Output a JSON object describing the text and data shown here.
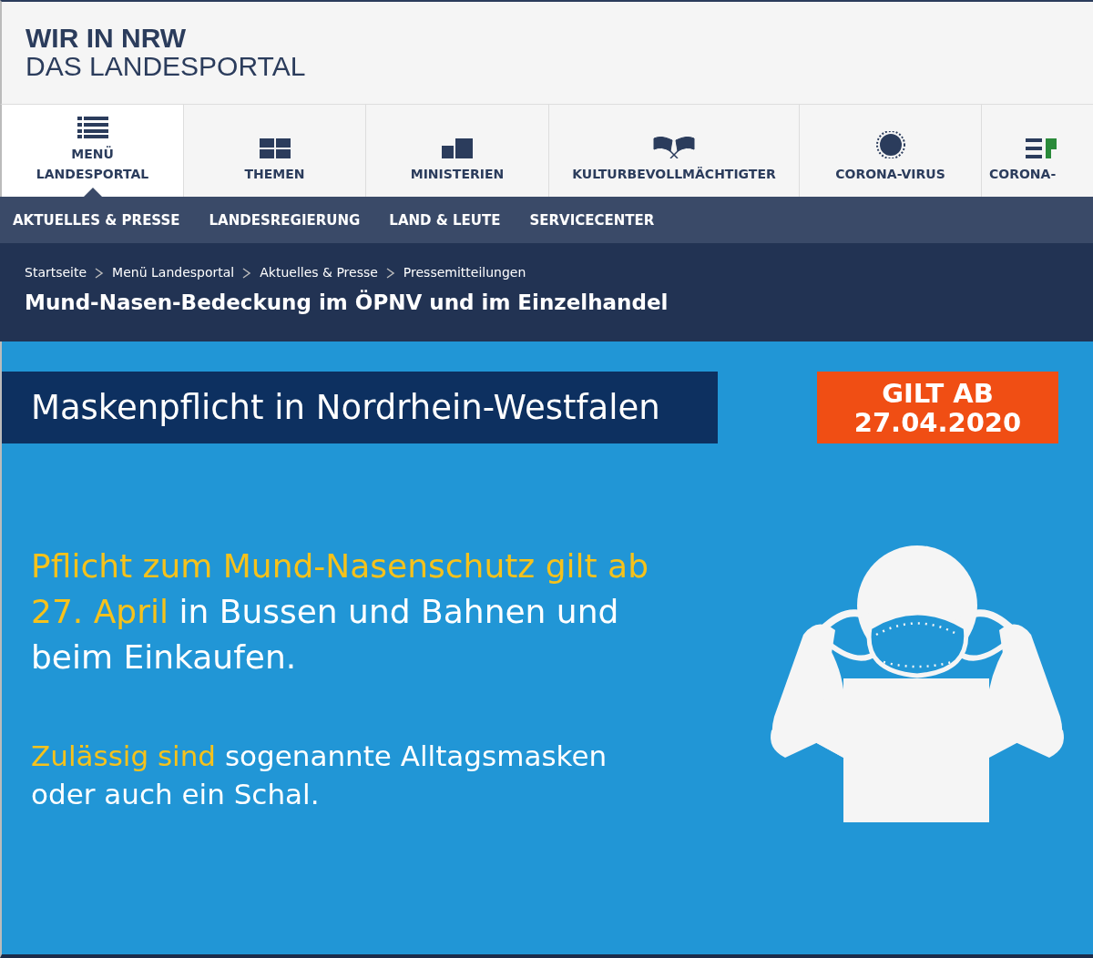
{
  "header": {
    "title": "WIR IN NRW",
    "subtitle": "DAS LANDESPORTAL"
  },
  "main_nav": [
    {
      "label": "MENÜ LANDESPORTAL",
      "selected": true
    },
    {
      "label": "THEMEN",
      "selected": false
    },
    {
      "label": "MINISTERIEN",
      "selected": false
    },
    {
      "label": "KULTURBEVOLLMÄCHTIGTER",
      "selected": false
    },
    {
      "label": "CORONA-VIRUS",
      "selected": false
    },
    {
      "label": "CORONA-",
      "selected": false
    }
  ],
  "sub_nav": [
    "AKTUELLES & PRESSE",
    "LANDESREGIERUNG",
    "LAND & LEUTE",
    "SERVICECENTER"
  ],
  "breadcrumb": [
    "Startseite",
    "Menü Landesportal",
    "Aktuelles & Presse",
    "Pressemitteilungen"
  ],
  "page_title": "Mund-Nasen-Bedeckung im ÖPNV und im Einzelhandel",
  "banner": {
    "title": "Maskenpflicht in Nordrhein-Westfalen",
    "badge": [
      "GILT AB",
      "27.04.2020"
    ],
    "paragraphs": [
      [
        {
          "text": "Pflicht zum Mund-Nasenschutz gilt ab 27. April",
          "highlight": true
        },
        {
          "text": " in Bussen und Bahnen und beim Einkaufen.",
          "highlight": false
        }
      ],
      [
        {
          "text": "Zulässig sind",
          "highlight": true
        },
        {
          "text": " sogenannte Alltagsmasken oder auch ein Schal.",
          "highlight": false
        }
      ]
    ]
  }
}
